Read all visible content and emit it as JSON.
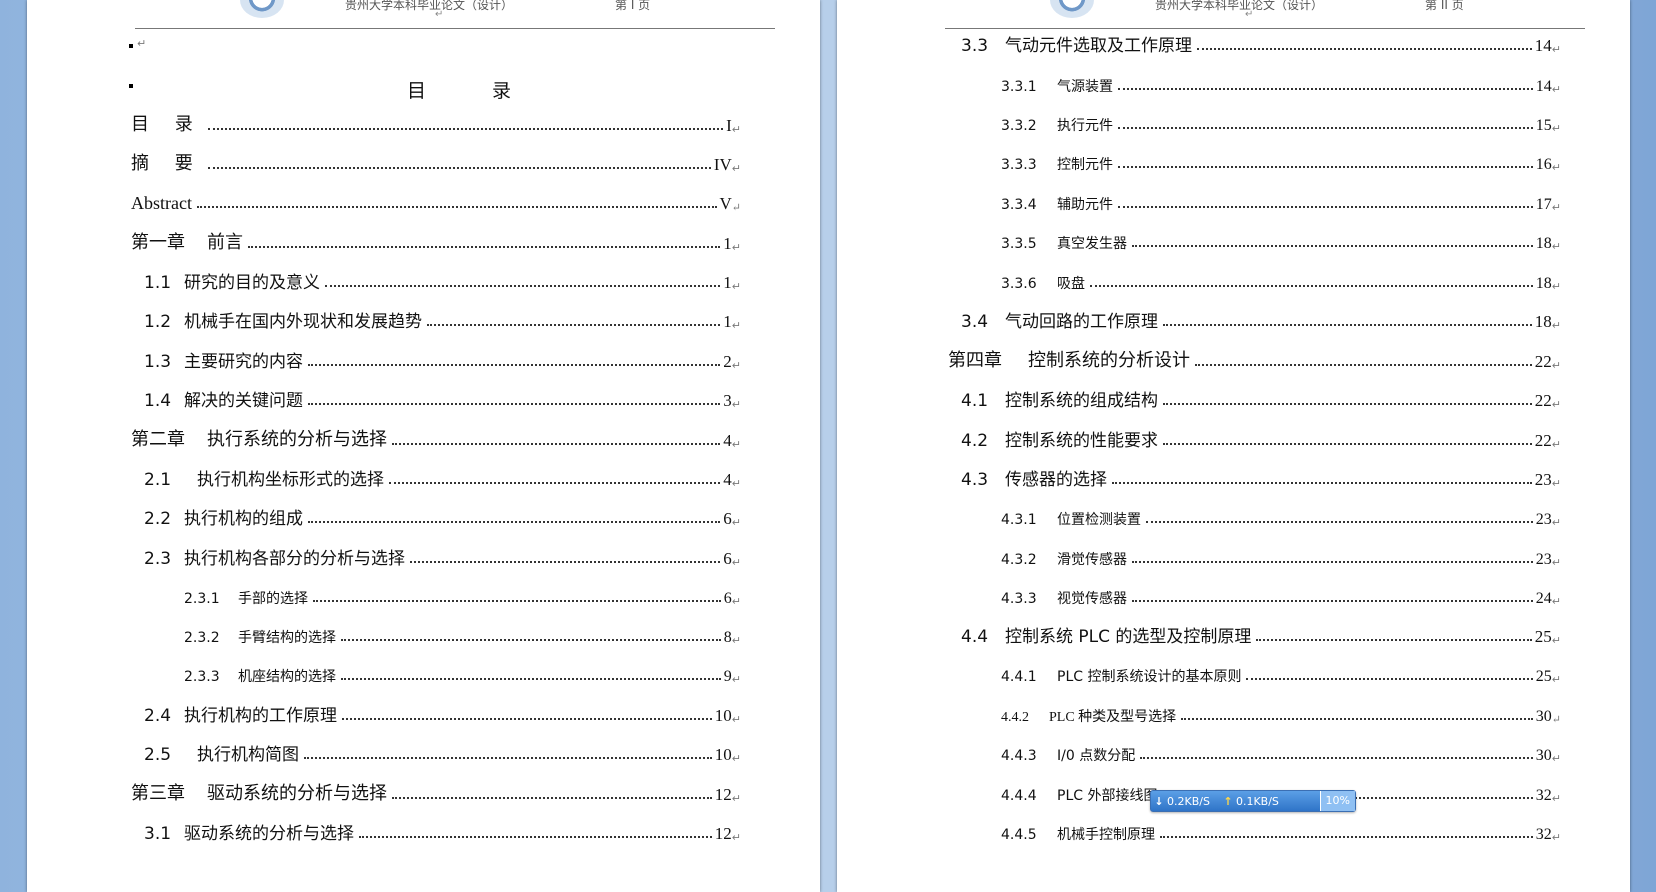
{
  "page1": {
    "header": {
      "title": "贵州大学本科毕业论文（设计）",
      "page_label": "第 I 页"
    },
    "toc_heading": "目    录",
    "entries": [
      {
        "num": "",
        "text": "目    录",
        "page": "I"
      },
      {
        "num": "",
        "text": "摘    要",
        "page": "IV"
      },
      {
        "num": "",
        "text": "Abstract",
        "page": "V"
      },
      {
        "num": "第一章",
        "text": "前言",
        "page": "1"
      },
      {
        "num": "1.1",
        "text": "研究的目的及意义",
        "page": "1"
      },
      {
        "num": "1.2",
        "text": "机械手在国内外现状和发展趋势",
        "page": "1"
      },
      {
        "num": "1.3",
        "text": "主要研究的内容",
        "page": "2"
      },
      {
        "num": "1.4",
        "text": "解决的关键问题",
        "page": "3"
      },
      {
        "num": "第二章",
        "text": "执行系统的分析与选择",
        "page": "4"
      },
      {
        "num": "2.1",
        "text": "执行机构坐标形式的选择",
        "page": "4"
      },
      {
        "num": "2.2",
        "text": "执行机构的组成",
        "page": "6"
      },
      {
        "num": "2.3",
        "text": "执行机构各部分的分析与选择",
        "page": "6"
      },
      {
        "num": "2.3.1",
        "text": "手部的选择",
        "page": "6"
      },
      {
        "num": "2.3.2",
        "text": "手臂结构的选择",
        "page": "8"
      },
      {
        "num": "2.3.3",
        "text": "机座结构的选择",
        "page": "9"
      },
      {
        "num": "2.4",
        "text": "执行机构的工作原理",
        "page": "10"
      },
      {
        "num": "2.5",
        "text": "执行机构简图",
        "page": "10"
      },
      {
        "num": "第三章",
        "text": "驱动系统的分析与选择",
        "page": "12"
      },
      {
        "num": "3.1",
        "text": "驱动系统的分析与选择",
        "page": "12"
      }
    ]
  },
  "page2": {
    "header": {
      "title": "贵州大学本科毕业论文（设计）",
      "page_label": "第 II 页"
    },
    "entries": [
      {
        "num": "3.3",
        "text": "气动元件选取及工作原理",
        "page": "14"
      },
      {
        "num": "3.3.1",
        "text": "气源装置",
        "page": "14"
      },
      {
        "num": "3.3.2",
        "text": "执行元件",
        "page": "15"
      },
      {
        "num": "3.3.3",
        "text": "控制元件",
        "page": "16"
      },
      {
        "num": "3.3.4",
        "text": "辅助元件",
        "page": "17"
      },
      {
        "num": "3.3.5",
        "text": "真空发生器",
        "page": "18"
      },
      {
        "num": "3.3.6",
        "text": "吸盘",
        "page": "18"
      },
      {
        "num": "3.4",
        "text": "气动回路的工作原理",
        "page": "18"
      },
      {
        "num": "第四章",
        "text": "控制系统的分析设计",
        "page": "22"
      },
      {
        "num": "4.1",
        "text": "控制系统的组成结构",
        "page": "22"
      },
      {
        "num": "4.2",
        "text": "控制系统的性能要求",
        "page": "22"
      },
      {
        "num": "4.3",
        "text": "传感器的选择",
        "page": "23"
      },
      {
        "num": "4.3.1",
        "text": "位置检测装置",
        "page": "23"
      },
      {
        "num": "4.3.2",
        "text": "滑觉传感器",
        "page": "23"
      },
      {
        "num": "4.3.3",
        "text": "视觉传感器",
        "page": "24"
      },
      {
        "num": "4.4",
        "text": "控制系统 PLC 的选型及控制原理",
        "page": "25"
      },
      {
        "num": "4.4.1",
        "text": "PLC 控制系统设计的基本原则",
        "page": "25"
      },
      {
        "num": "4.4.2",
        "text": "PLC 种类及型号选择",
        "page": "30"
      },
      {
        "num": "4.4.3",
        "text": "I/0 点数分配",
        "page": "30"
      },
      {
        "num": "4.4.4",
        "text": "PLC 外部接线图",
        "page": "32"
      },
      {
        "num": "4.4.5",
        "text": "机械手控制原理",
        "page": "32"
      }
    ]
  },
  "net_widget": {
    "down": "0.2KB/S",
    "up": "0.1KB/S",
    "pct": "10%"
  }
}
